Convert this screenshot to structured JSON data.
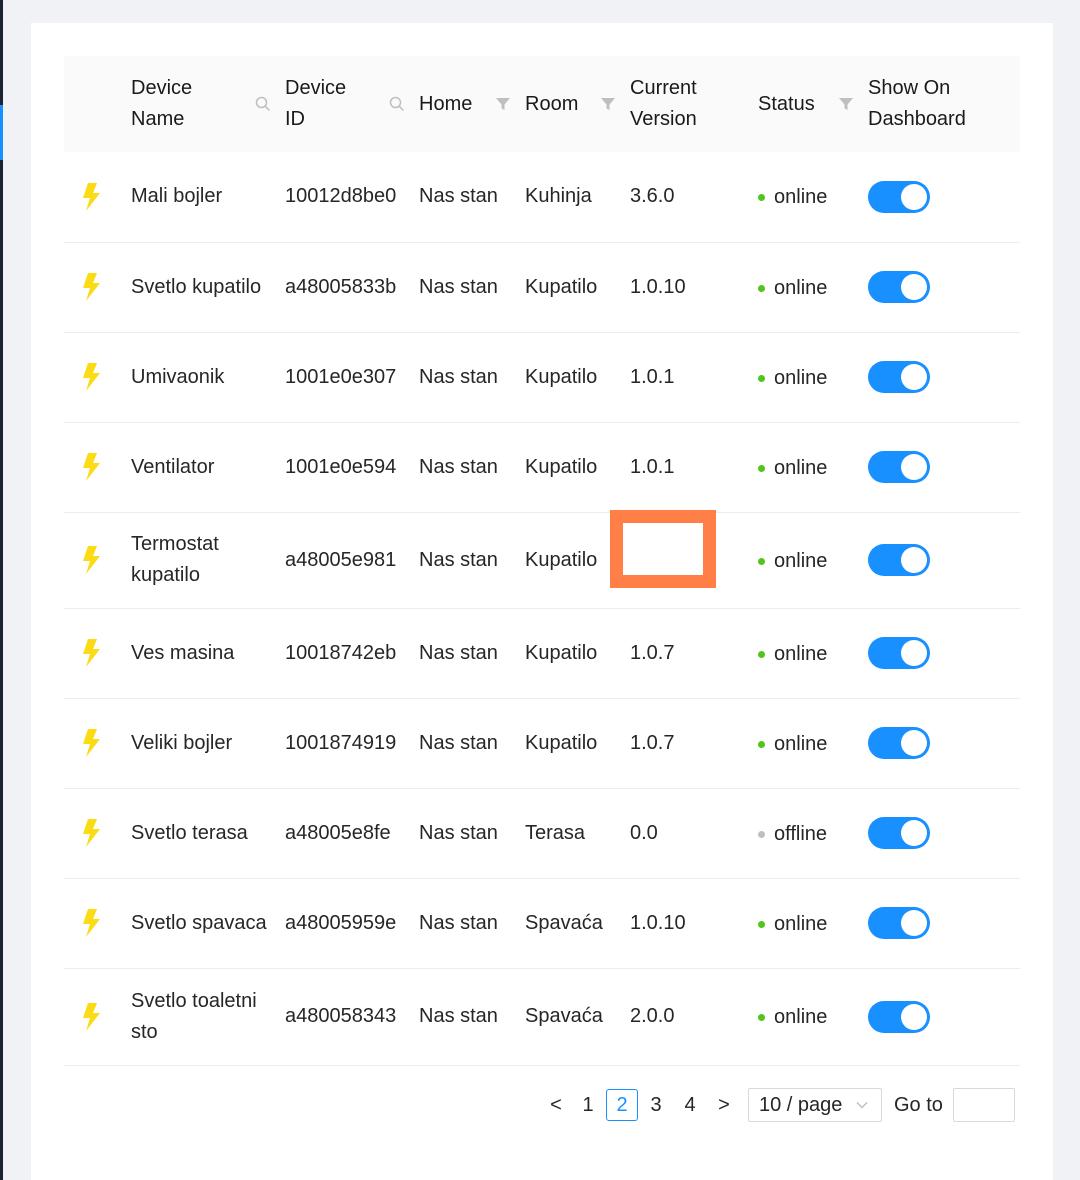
{
  "table": {
    "headers": {
      "device_name": "Device Name",
      "device_id": "Device ID",
      "home": "Home",
      "room": "Room",
      "current_version": "Current Version",
      "status": "Status",
      "show_on_dashboard": "Show On Dashboard"
    },
    "rows": [
      {
        "name": "Mali bojler",
        "id": "10012d8be0",
        "home": "Nas stan",
        "room": "Kuhinja",
        "version": "3.6.0",
        "status": "online",
        "dashboard": true
      },
      {
        "name": "Svetlo kupatilo",
        "id": "a48005833b",
        "home": "Nas stan",
        "room": "Kupatilo",
        "version": "1.0.10",
        "status": "online",
        "dashboard": true
      },
      {
        "name": "Umivaonik",
        "id": "1001e0e307",
        "home": "Nas stan",
        "room": "Kupatilo",
        "version": "1.0.1",
        "status": "online",
        "dashboard": true
      },
      {
        "name": "Ventilator",
        "id": "1001e0e594",
        "home": "Nas stan",
        "room": "Kupatilo",
        "version": "1.0.1",
        "status": "online",
        "dashboard": true
      },
      {
        "name": "Termostat kupatilo",
        "id": "a48005e981",
        "home": "Nas stan",
        "room": "Kupatilo",
        "version": "",
        "status": "online",
        "dashboard": true
      },
      {
        "name": "Ves masina",
        "id": "10018742eb",
        "home": "Nas stan",
        "room": "Kupatilo",
        "version": "1.0.7",
        "status": "online",
        "dashboard": true
      },
      {
        "name": "Veliki bojler",
        "id": "1001874919",
        "home": "Nas stan",
        "room": "Kupatilo",
        "version": "1.0.7",
        "status": "online",
        "dashboard": true
      },
      {
        "name": "Svetlo terasa",
        "id": "a48005e8fe",
        "home": "Nas stan",
        "room": "Terasa",
        "version": "0.0",
        "status": "offline",
        "dashboard": true
      },
      {
        "name": "Svetlo spavaca",
        "id": "a48005959e",
        "home": "Nas stan",
        "room": "Spavaća",
        "version": "1.0.10",
        "status": "online",
        "dashboard": true
      },
      {
        "name": "Svetlo toaletni sto",
        "id": "a480058343",
        "home": "Nas stan",
        "room": "Spavaća",
        "version": "2.0.0",
        "status": "online",
        "dashboard": true
      }
    ]
  },
  "pagination": {
    "prev": "<",
    "pages": [
      "1",
      "2",
      "3",
      "4"
    ],
    "current_page": "2",
    "next": ">",
    "page_size": "10 / page",
    "goto_label": "Go to",
    "goto_value": ""
  },
  "colors": {
    "accent": "#1890ff",
    "online": "#52c41a",
    "offline": "#bfbfbf",
    "bolt": "#fadb14",
    "highlight": "#ff7f47"
  },
  "icons": {
    "device": "lightning-icon",
    "search": "search-icon",
    "filter": "filter-icon",
    "dropdown": "chevron-down-icon"
  }
}
